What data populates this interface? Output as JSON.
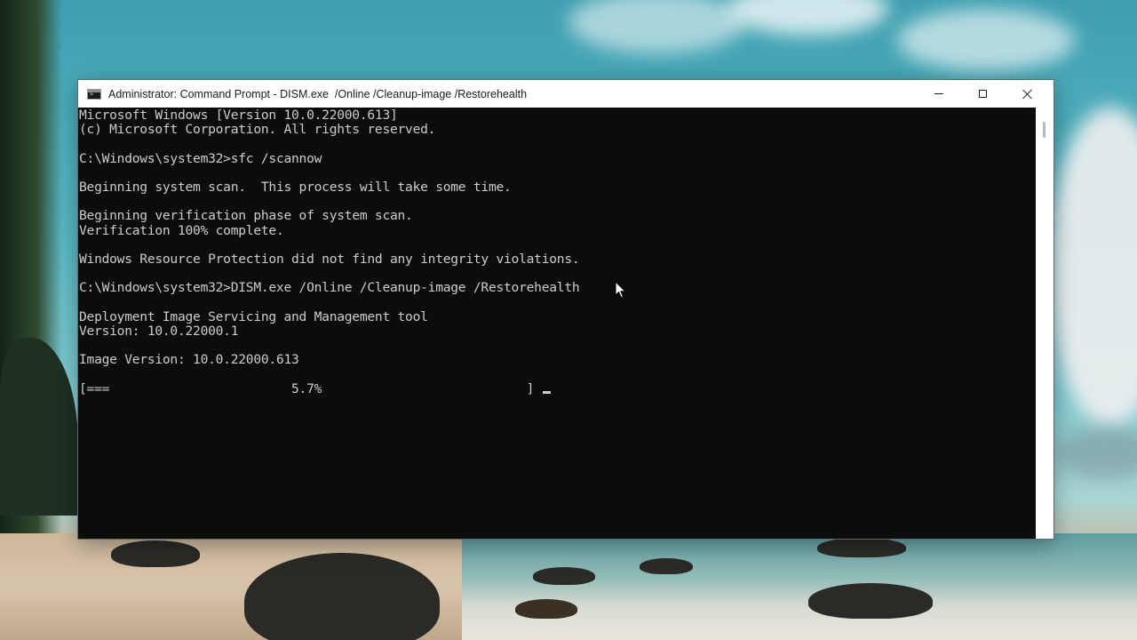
{
  "window": {
    "title": "Administrator: Command Prompt - DISM.exe  /Online /Cleanup-image /Restorehealth",
    "icon": "cmd-icon",
    "controls": [
      "minimize-icon",
      "maximize-icon",
      "close-icon"
    ]
  },
  "console": {
    "lines": [
      "Microsoft Windows [Version 10.0.22000.613]",
      "(c) Microsoft Corporation. All rights reserved.",
      "",
      "C:\\Windows\\system32>sfc /scannow",
      "",
      "Beginning system scan.  This process will take some time.",
      "",
      "Beginning verification phase of system scan.",
      "Verification 100% complete.",
      "",
      "Windows Resource Protection did not find any integrity violations.",
      "",
      "C:\\Windows\\system32>DISM.exe /Online /Cleanup-image /Restorehealth",
      "",
      "Deployment Image Servicing and Management tool",
      "Version: 10.0.22000.1",
      "",
      "Image Version: 10.0.22000.613",
      "",
      "[===                        5.7%                           ]"
    ],
    "progress_percent": 5.7
  },
  "colors": {
    "console_background": "#0c0c0c",
    "console_text": "#cccccc",
    "title_bar": "#ffffff"
  }
}
